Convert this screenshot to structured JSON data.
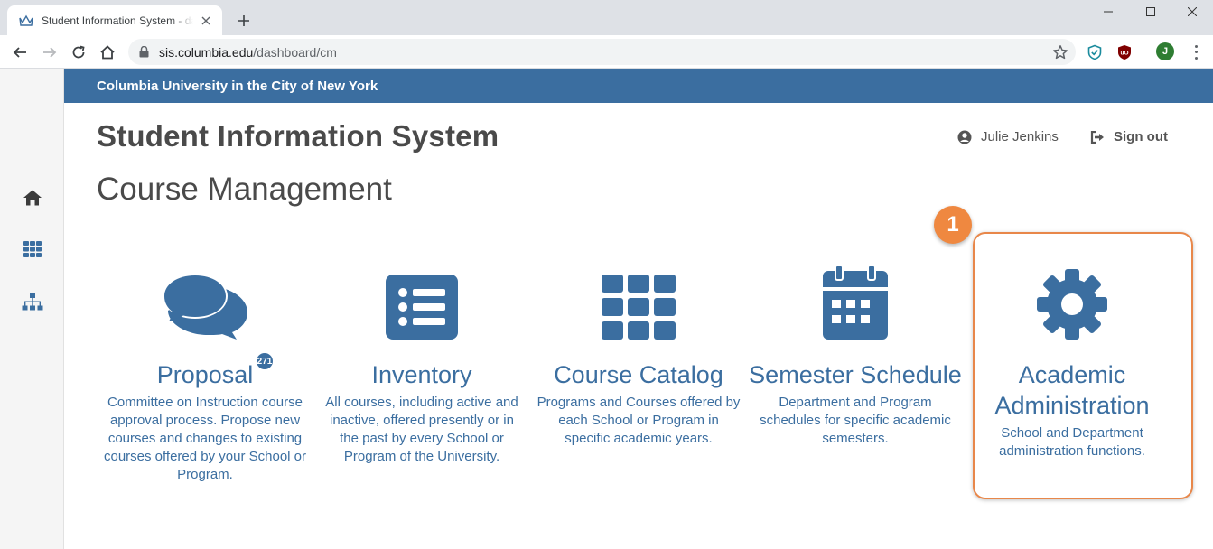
{
  "browser": {
    "tab_title": "Student Information System - dashboard",
    "new_tab_label": "+",
    "url_host": "sis.columbia.edu",
    "url_path": "/dashboard/cm",
    "profile_initial": "J"
  },
  "page": {
    "banner": "Columbia University in the City of New York",
    "app_title": "Student Information System",
    "section_title": "Course Management",
    "user_name": "Julie Jenkins",
    "sign_out_label": "Sign out",
    "callout_number": "1"
  },
  "sidebar": {
    "items": [
      {
        "icon": "home-icon"
      },
      {
        "icon": "grid-icon"
      },
      {
        "icon": "sitemap-icon"
      }
    ]
  },
  "cards": [
    {
      "icon": "comments-icon",
      "title": "Proposal",
      "badge": "271",
      "description": "Committee on Instruction course approval process. Propose new courses and changes to existing courses offered by your School or Program."
    },
    {
      "icon": "list-icon",
      "title": "Inventory",
      "description": "All courses, including active and inactive, offered presently or in the past by every School or Program of the University."
    },
    {
      "icon": "grid-icon",
      "title": "Course Catalog",
      "description": "Programs and Courses offered by each School or Program in specific academic years."
    },
    {
      "icon": "calendar-icon",
      "title": "Semester Schedule",
      "description": "Department and Program schedules for specific academic semesters."
    },
    {
      "icon": "gear-icon",
      "title": "Academic Administration",
      "description": "School and Department administration functions."
    }
  ],
  "colors": {
    "brand_blue": "#3b6ea0",
    "callout_orange": "#ef8840",
    "heading_gray": "#4a4a4a"
  }
}
